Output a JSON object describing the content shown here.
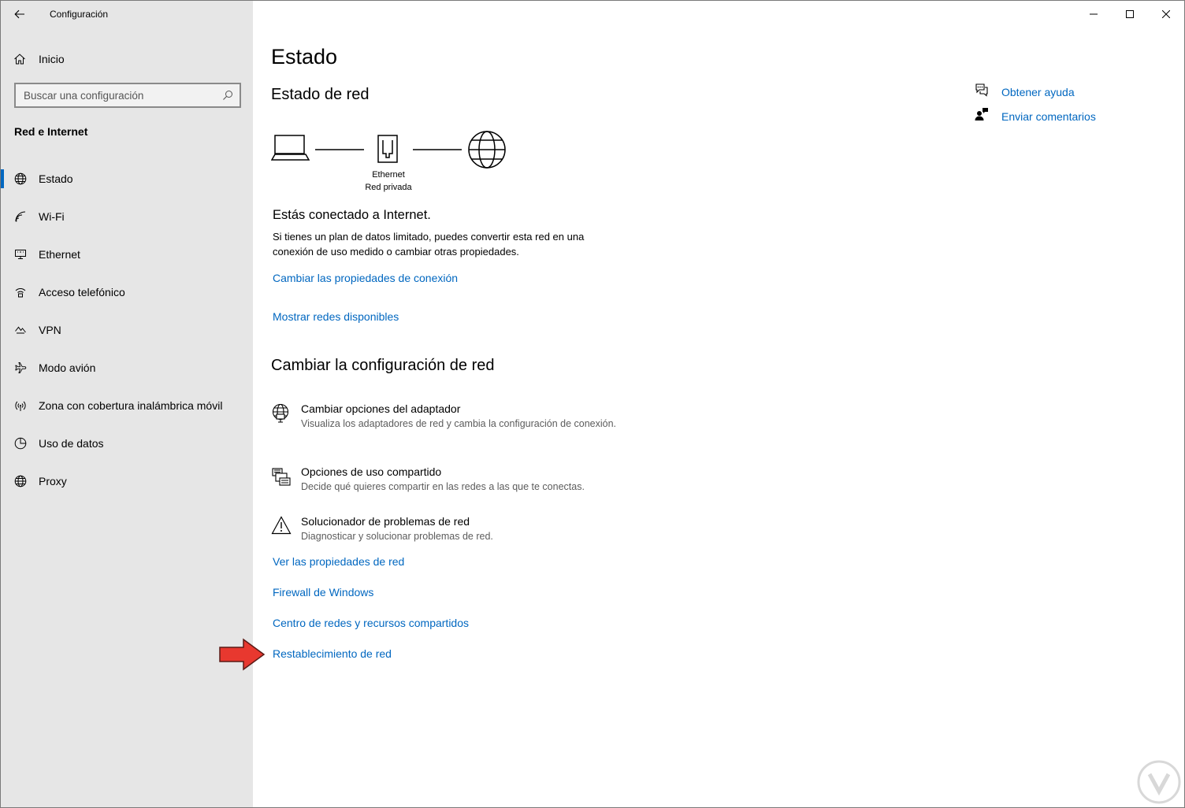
{
  "window": {
    "title": "Configuración",
    "back_icon": "arrow-left-icon",
    "controls": [
      "minimize-icon",
      "maximize-icon",
      "close-icon"
    ]
  },
  "sidebar": {
    "home_label": "Inicio",
    "search_placeholder": "Buscar una configuración",
    "section_title": "Red e Internet",
    "items": [
      {
        "label": "Estado",
        "icon": "globe-icon",
        "active": true
      },
      {
        "label": "Wi-Fi",
        "icon": "wifi-icon",
        "active": false
      },
      {
        "label": "Ethernet",
        "icon": "ethernet-icon",
        "active": false
      },
      {
        "label": "Acceso telefónico",
        "icon": "dialup-icon",
        "active": false
      },
      {
        "label": "VPN",
        "icon": "vpn-icon",
        "active": false
      },
      {
        "label": "Modo avión",
        "icon": "airplane-icon",
        "active": false
      },
      {
        "label": "Zona con cobertura inalámbrica móvil",
        "icon": "hotspot-icon",
        "active": false
      },
      {
        "label": "Uso de datos",
        "icon": "data-usage-icon",
        "active": false
      },
      {
        "label": "Proxy",
        "icon": "globe-icon",
        "active": false
      }
    ]
  },
  "main": {
    "title": "Estado",
    "subtitle": "Estado de red",
    "diagram": {
      "line1": "Ethernet",
      "line2": "Red privada"
    },
    "connected_text": "Estás conectado a Internet.",
    "description": "Si tienes un plan de datos limitado, puedes convertir esta red en una conexión de uso medido o cambiar otras propiedades.",
    "link_change_props": "Cambiar las propiedades de conexión",
    "link_show_networks": "Mostrar redes disponibles",
    "section2_title": "Cambiar la configuración de red",
    "options": [
      {
        "title": "Cambiar opciones del adaptador",
        "desc": "Visualiza los adaptadores de red y cambia la configuración de conexión.",
        "icon": "adapter-icon"
      },
      {
        "title": "Opciones de uso compartido",
        "desc": "Decide qué quieres compartir en las redes a las que te conectas.",
        "icon": "sharing-icon"
      },
      {
        "title": "Solucionador de problemas de red",
        "desc": "Diagnosticar y solucionar problemas de red.",
        "icon": "warning-icon"
      }
    ],
    "links": [
      "Ver las propiedades de red",
      "Firewall de Windows",
      "Centro de redes y recursos compartidos",
      "Restablecimiento de red"
    ]
  },
  "help": {
    "get_help": "Obtener ayuda",
    "feedback": "Enviar comentarios"
  },
  "colors": {
    "accent": "#0067c0",
    "sidebar_bg": "#e6e6e6",
    "arrow": "#e8382f"
  }
}
